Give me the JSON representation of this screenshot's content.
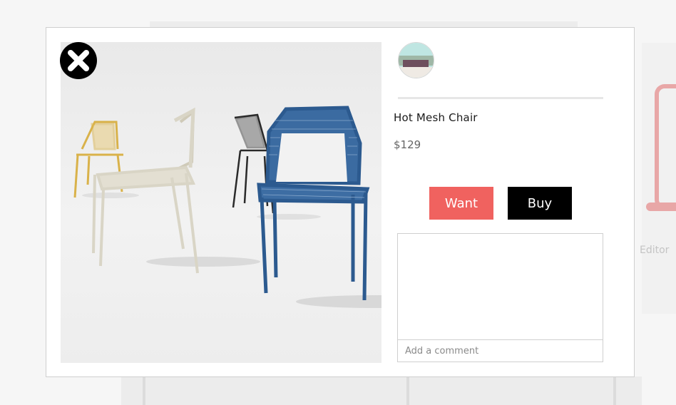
{
  "background": {
    "side_label": "Editor"
  },
  "modal": {
    "close_icon": "close-icon",
    "product": {
      "title": "Hot Mesh Chair",
      "price": "$129",
      "image_alt": "Hot Mesh Chairs in yellow, cream, black and blue"
    },
    "actions": {
      "want_label": "Want",
      "buy_label": "Buy"
    },
    "comments": {
      "placeholder": "Add a comment",
      "value": ""
    }
  },
  "colors": {
    "want": "#f0625f",
    "buy": "#000000",
    "chair_yellow": "#d9b24a",
    "chair_cream": "#d9d5c6",
    "chair_black": "#2a2a2a",
    "chair_blue": "#2c5a8f"
  }
}
